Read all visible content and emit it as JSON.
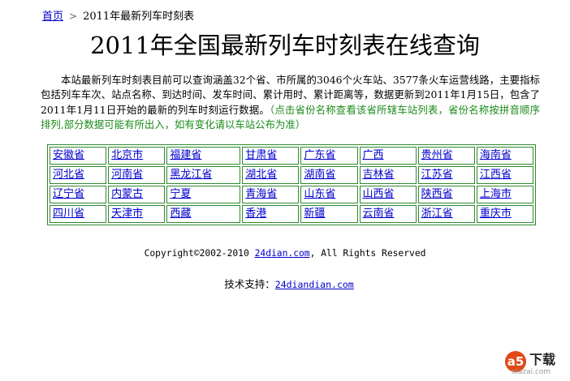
{
  "breadcrumb": {
    "home": "首页",
    "separator": ">",
    "current": "2011年最新列车时刻表"
  },
  "title": "2011年全国最新列车时刻表在线查询",
  "intro": {
    "text": "本站最新列车时刻表目前可以查询涵盖32个省、市所属的3046个火车站、3577条火车运营线路，主要指标包括列车车次、站点名称、到达时间、发车时间、累计用时、累计距离等，数据更新到2011年1月15日，包含了2011年1月11日开始的最新的列车时刻运行数据。",
    "note": "（点击省份名称查看该省所辖车站列表，省份名称按拼音顺序排列,部分数据可能有所出入，如有变化请以车站公布为准）"
  },
  "provinces": [
    [
      "安徽省",
      "北京市",
      "福建省",
      "甘肃省",
      "广东省",
      "广西",
      "贵州省",
      "海南省"
    ],
    [
      "河北省",
      "河南省",
      "黑龙江省",
      "湖北省",
      "湖南省",
      "吉林省",
      "江苏省",
      "江西省"
    ],
    [
      "辽宁省",
      "内蒙古",
      "宁夏",
      "青海省",
      "山东省",
      "山西省",
      "陕西省",
      "上海市"
    ],
    [
      "四川省",
      "天津市",
      "西藏",
      "香港",
      "新疆",
      "云南省",
      "浙江省",
      "重庆市"
    ]
  ],
  "footer": {
    "copyright_prefix": "Copyright©2002-2010 ",
    "copyright_link": "24dian.com",
    "copyright_suffix": ", All Rights Reserved",
    "support_label": "技术支持：",
    "support_link": "24diandian.com"
  },
  "watermark": {
    "badge": "a5",
    "text": "下载",
    "site": "xiazai.com"
  },
  "colors": {
    "link": "#0000cc",
    "note": "#1a8a1a",
    "table_border": "#2f8a2f"
  }
}
